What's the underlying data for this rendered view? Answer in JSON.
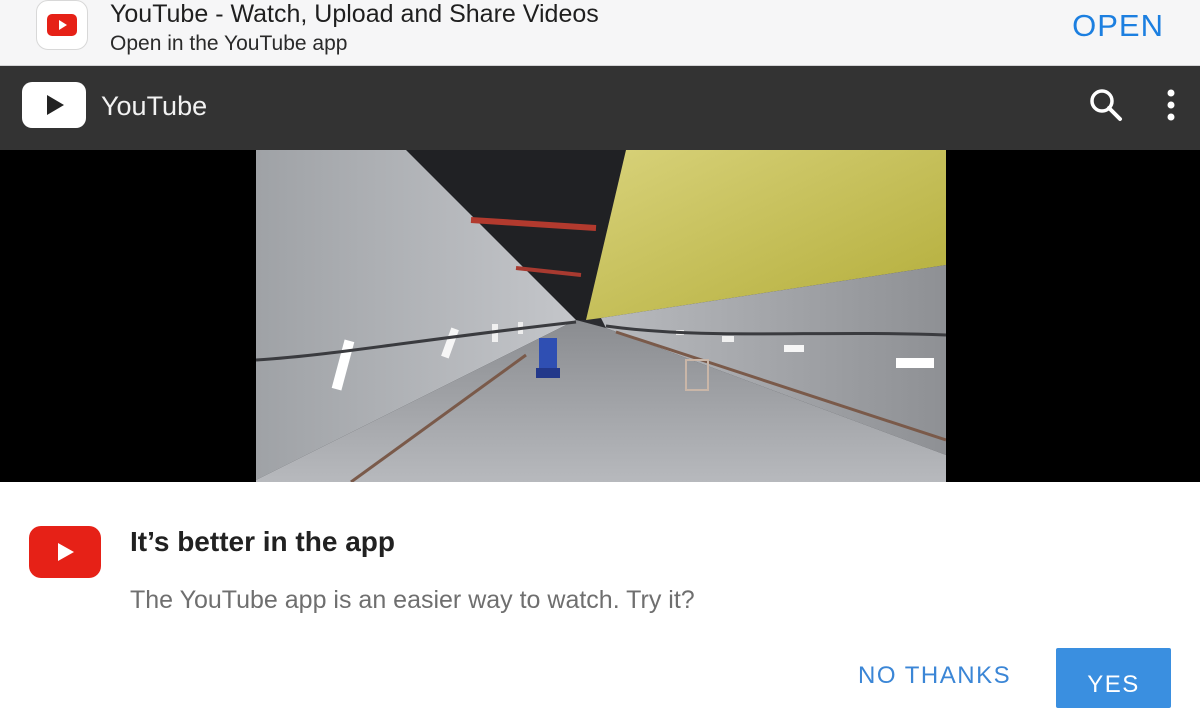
{
  "app_banner": {
    "title": "YouTube - Watch, Upload and Share Videos",
    "subtitle": "Open in the YouTube app",
    "open_label": "OPEN",
    "icon": "youtube-logo-icon"
  },
  "topbar": {
    "title": "YouTube",
    "logo_icon": "youtube-play-icon",
    "search_icon": "search-icon",
    "menu_icon": "more-vertical-icon"
  },
  "player": {
    "content": "video-thumbnail"
  },
  "dialog": {
    "title": "It’s better in the app",
    "body": "The YouTube app is an easier way to watch. Try it?",
    "no_thanks_label": "NO THANKS",
    "yes_label": "YES",
    "icon": "youtube-logo-icon"
  },
  "colors": {
    "brand_red": "#e62117",
    "accent_blue": "#1c7fe0",
    "topbar_bg": "#333333"
  }
}
